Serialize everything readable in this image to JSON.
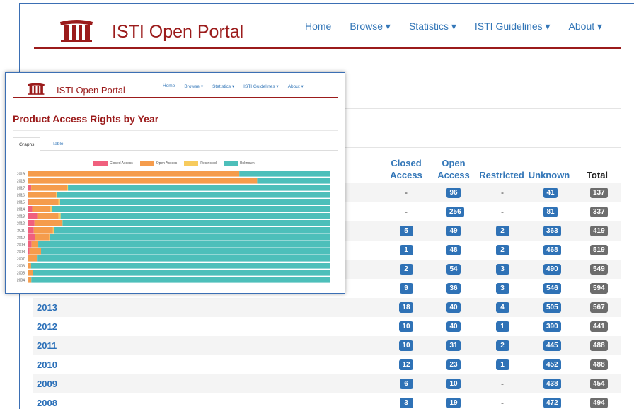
{
  "portal": {
    "brand": "ISTI Open Portal",
    "nav": [
      "Home",
      "Browse ▾",
      "Statistics ▾",
      "ISTI Guidelines ▾",
      "About ▾"
    ]
  },
  "table": {
    "headers": {
      "closed": "Closed Access",
      "open": "Open Access",
      "restricted": "Restricted",
      "unknown": "Unknown",
      "total": "Total"
    },
    "rows": [
      {
        "year": "",
        "closed": "-",
        "open": "96",
        "restricted": "-",
        "unknown": "41",
        "total": "137"
      },
      {
        "year": "",
        "closed": "-",
        "open": "256",
        "restricted": "-",
        "unknown": "81",
        "total": "337"
      },
      {
        "year": "",
        "closed": "5",
        "open": "49",
        "restricted": "2",
        "unknown": "363",
        "total": "419"
      },
      {
        "year": "",
        "closed": "1",
        "open": "48",
        "restricted": "2",
        "unknown": "468",
        "total": "519"
      },
      {
        "year": "",
        "closed": "2",
        "open": "54",
        "restricted": "3",
        "unknown": "490",
        "total": "549"
      },
      {
        "year": "",
        "closed": "9",
        "open": "36",
        "restricted": "3",
        "unknown": "546",
        "total": "594"
      },
      {
        "year": "2013",
        "closed": "18",
        "open": "40",
        "restricted": "4",
        "unknown": "505",
        "total": "567"
      },
      {
        "year": "2012",
        "closed": "10",
        "open": "40",
        "restricted": "1",
        "unknown": "390",
        "total": "441"
      },
      {
        "year": "2011",
        "closed": "10",
        "open": "31",
        "restricted": "2",
        "unknown": "445",
        "total": "488"
      },
      {
        "year": "2010",
        "closed": "12",
        "open": "23",
        "restricted": "1",
        "unknown": "452",
        "total": "488"
      },
      {
        "year": "2009",
        "closed": "6",
        "open": "10",
        "restricted": "-",
        "unknown": "438",
        "total": "454"
      },
      {
        "year": "2008",
        "closed": "3",
        "open": "19",
        "restricted": "-",
        "unknown": "472",
        "total": "494"
      }
    ]
  },
  "overlay": {
    "brand": "ISTI Open Portal",
    "nav": [
      "Home",
      "Browse ▾",
      "Statistics ▾",
      "ISTI Guidelines ▾",
      "About ▾"
    ],
    "title": "Product Access Rights by Year",
    "tabs": [
      "Graphs",
      "Table"
    ]
  },
  "chart_data": {
    "type": "bar",
    "orientation": "horizontal",
    "stacked": true,
    "normalized": true,
    "categories": [
      "2019",
      "2018",
      "2017",
      "2016",
      "2015",
      "2014",
      "2013",
      "2012",
      "2011",
      "2010",
      "2009",
      "2008",
      "2007",
      "2006",
      "2005",
      "2004"
    ],
    "series": [
      {
        "name": "Closed Access",
        "color": "#f0607e",
        "values": [
          0,
          0,
          5,
          1,
          2,
          9,
          18,
          10,
          10,
          12,
          6,
          3,
          1,
          1,
          0,
          1
        ]
      },
      {
        "name": "Open Access",
        "color": "#f59c4c",
        "values": [
          96,
          256,
          49,
          48,
          54,
          36,
          40,
          40,
          31,
          23,
          10,
          19,
          13,
          4,
          8,
          4
        ]
      },
      {
        "name": "Restricted",
        "color": "#f7cb5d",
        "values": [
          0,
          0,
          2,
          2,
          3,
          3,
          4,
          1,
          2,
          1,
          0,
          0,
          0,
          0,
          0,
          0
        ]
      },
      {
        "name": "Unknown",
        "color": "#4dbfba",
        "values": [
          41,
          81,
          363,
          468,
          490,
          546,
          505,
          390,
          445,
          452,
          438,
          472,
          440,
          430,
          420,
          400
        ]
      }
    ],
    "xlim": [
      0,
      100
    ],
    "legend": "top"
  }
}
